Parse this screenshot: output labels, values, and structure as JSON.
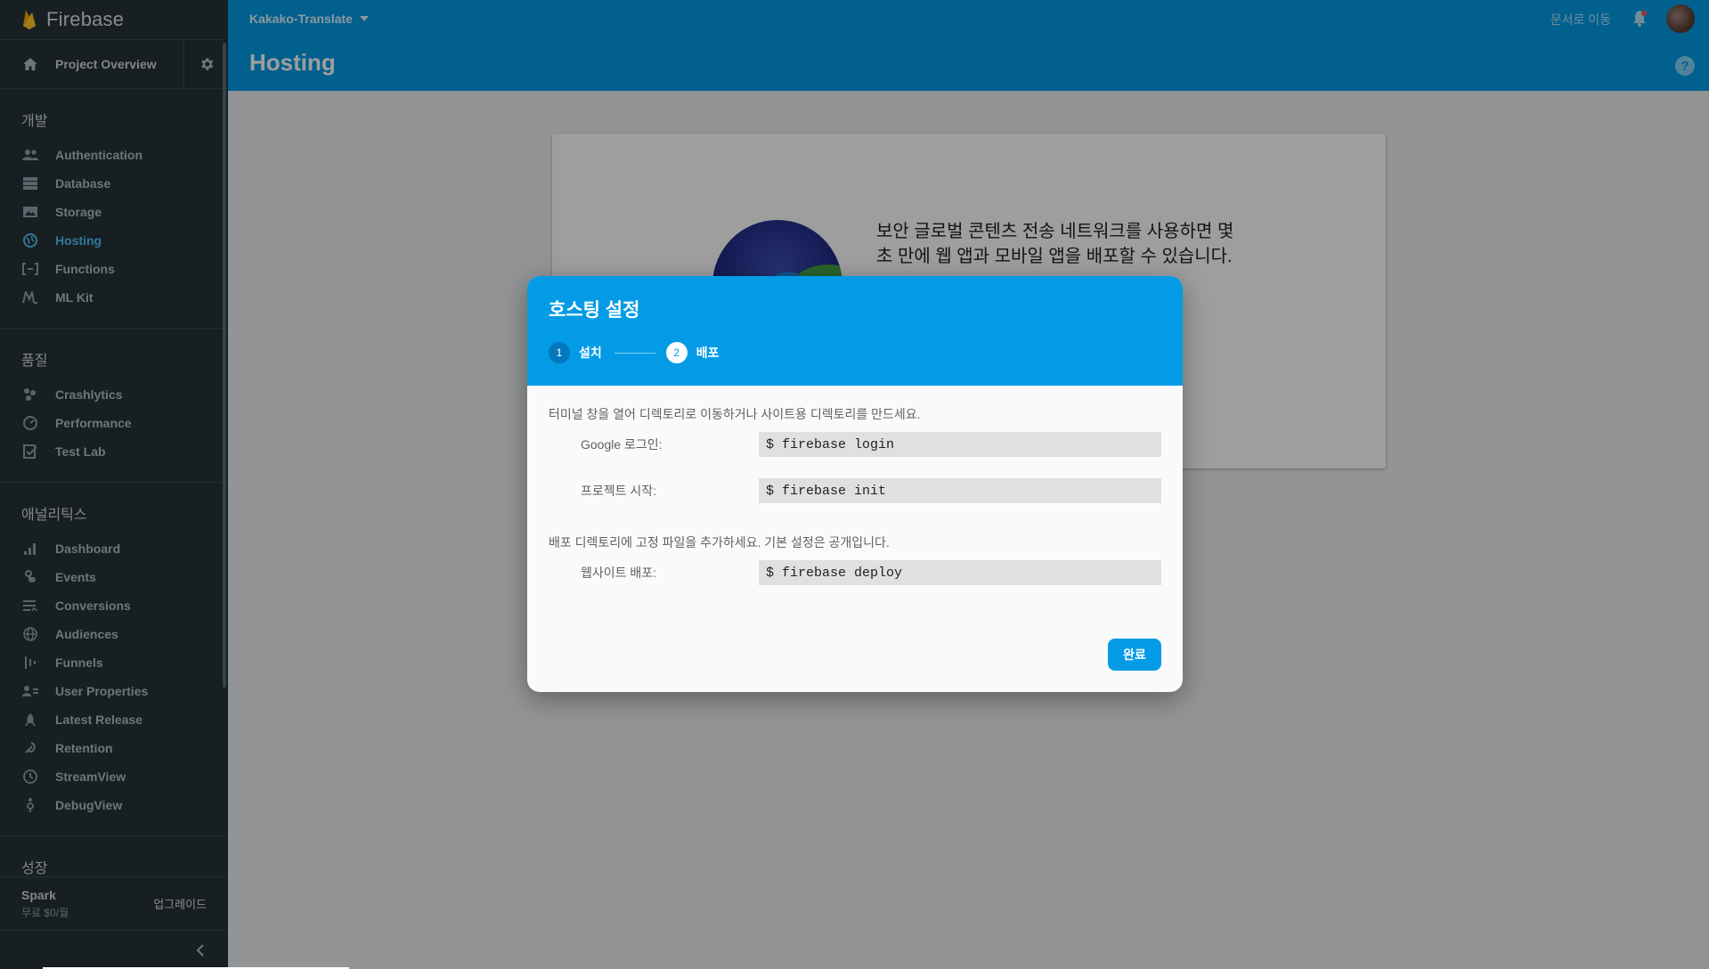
{
  "brand": {
    "name": "Firebase"
  },
  "sidebar": {
    "project_overview": "Project Overview",
    "sections": [
      {
        "title": "개발",
        "items": [
          {
            "label": "Authentication",
            "icon": "people-icon"
          },
          {
            "label": "Database",
            "icon": "database-icon"
          },
          {
            "label": "Storage",
            "icon": "storage-icon"
          },
          {
            "label": "Hosting",
            "icon": "globe-icon",
            "active": true
          },
          {
            "label": "Functions",
            "icon": "functions-icon"
          },
          {
            "label": "ML Kit",
            "icon": "mlkit-icon"
          }
        ]
      },
      {
        "title": "품질",
        "items": [
          {
            "label": "Crashlytics",
            "icon": "crashlytics-icon"
          },
          {
            "label": "Performance",
            "icon": "performance-icon"
          },
          {
            "label": "Test Lab",
            "icon": "testlab-icon"
          }
        ]
      },
      {
        "title": "애널리틱스",
        "items": [
          {
            "label": "Dashboard",
            "icon": "bar-chart-icon"
          },
          {
            "label": "Events",
            "icon": "touch-icon"
          },
          {
            "label": "Conversions",
            "icon": "conversions-icon"
          },
          {
            "label": "Audiences",
            "icon": "audiences-icon"
          },
          {
            "label": "Funnels",
            "icon": "funnels-icon"
          },
          {
            "label": "User Properties",
            "icon": "user-properties-icon"
          },
          {
            "label": "Latest Release",
            "icon": "release-icon"
          },
          {
            "label": "Retention",
            "icon": "retention-icon"
          },
          {
            "label": "StreamView",
            "icon": "clock-icon"
          },
          {
            "label": "DebugView",
            "icon": "debug-icon"
          }
        ]
      },
      {
        "title": "성장",
        "items": []
      }
    ],
    "plan": {
      "name": "Spark",
      "price": "무료 $0/월",
      "upgrade": "업그레이드"
    }
  },
  "header": {
    "project_name": "Kakako-Translate",
    "page_title": "Hosting",
    "docs_link": "문서로 이동"
  },
  "card": {
    "text": "보안 글로벌 콘텐츠 전송 네트워크를 사용하면 몇 초 만에 웹 앱과 모바일 앱을 배포할 수 있습니다."
  },
  "modal": {
    "title": "호스팅 설정",
    "steps": [
      {
        "number": "1",
        "label": "설치"
      },
      {
        "number": "2",
        "label": "배포"
      }
    ],
    "instruction_1": "터미널 창을 열어 디렉토리로 이동하거나 사이트용 디렉토리를 만드세요.",
    "instruction_2": "배포 디렉토리에 고정 파일을 추가하세요. 기본 설정은 공개입니다.",
    "commands": [
      {
        "label": "Google 로그인:",
        "command": "$ firebase login"
      },
      {
        "label": "프로젝트 시작:",
        "command": "$ firebase init"
      },
      {
        "label": "웹사이트 배포:",
        "command": "$ firebase deploy"
      }
    ],
    "done_button": "완료"
  },
  "colors": {
    "accent": "#039be5",
    "sidebar_bg": "#263238",
    "active_nav": "#4fc3f7"
  }
}
